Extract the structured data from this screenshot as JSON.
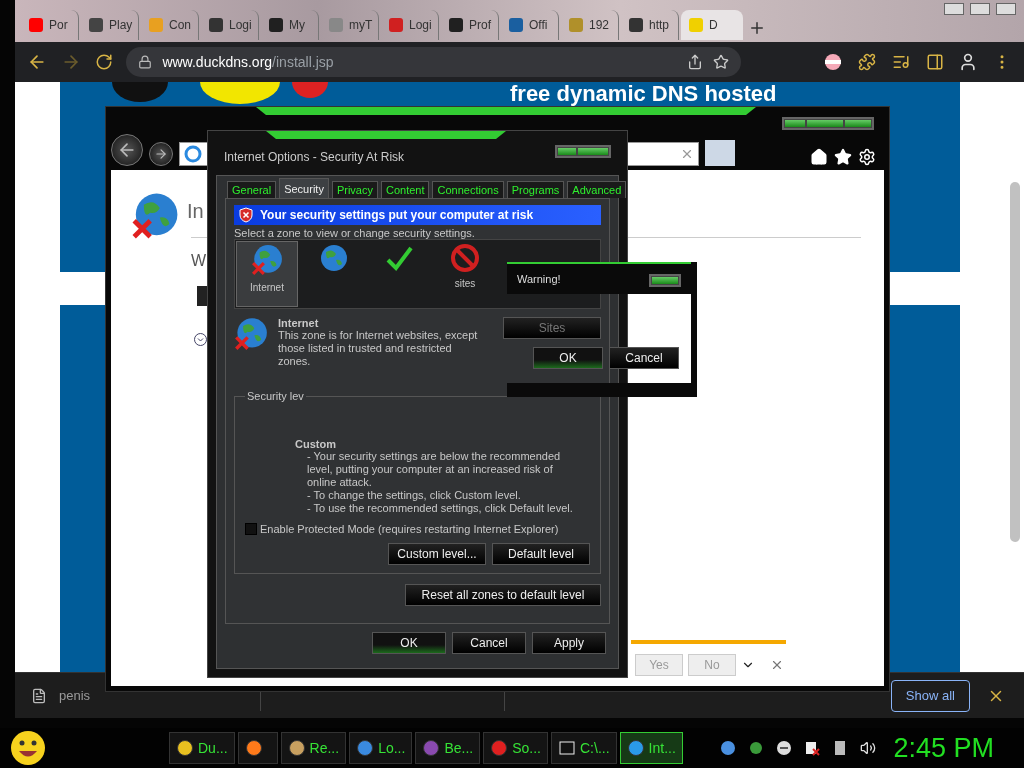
{
  "browser": {
    "tabs": [
      {
        "label": "Por",
        "color": "#ff0000",
        "selected": false
      },
      {
        "label": "Play",
        "color": "#444444",
        "selected": false
      },
      {
        "label": "Con",
        "color": "#e8a020",
        "selected": false
      },
      {
        "label": "Logi",
        "color": "#333333",
        "selected": false
      },
      {
        "label": "My",
        "color": "#202020",
        "selected": false
      },
      {
        "label": "myT",
        "color": "#888888",
        "selected": false
      },
      {
        "label": "Logi",
        "color": "#d02020",
        "selected": false
      },
      {
        "label": "Prof",
        "color": "#202020",
        "selected": false
      },
      {
        "label": "Offi",
        "color": "#1a5fa0",
        "selected": false
      },
      {
        "label": "192",
        "color": "#b0902a",
        "selected": false
      },
      {
        "label": "http",
        "color": "#333333",
        "selected": false
      },
      {
        "label": "D",
        "color": "#f0d000",
        "selected": true
      }
    ],
    "address": {
      "domain": "www.duckdns.org",
      "path": "/install.jsp"
    }
  },
  "page": {
    "heading": "free dynamic DNS hosted"
  },
  "ie_window": {
    "page_title": "In",
    "page_text": "W",
    "notification": {
      "buttons": [
        "Yes",
        "No"
      ]
    }
  },
  "options_dialog": {
    "title": "Internet Options - Security At Risk",
    "tabs": [
      {
        "label": "General",
        "selected": false
      },
      {
        "label": "Security",
        "selected": true
      },
      {
        "label": "Privacy",
        "selected": false
      },
      {
        "label": "Content",
        "selected": false
      },
      {
        "label": "Connections",
        "selected": false
      },
      {
        "label": "Programs",
        "selected": false
      },
      {
        "label": "Advanced",
        "selected": false
      }
    ],
    "banner": "Your security settings put your computer at risk",
    "zone_prompt": "Select a zone to view or change security settings.",
    "zones": [
      {
        "kind": "internet",
        "label": "Internet",
        "selected": true
      },
      {
        "kind": "intranet",
        "selected": false
      },
      {
        "kind": "trusted",
        "selected": false
      },
      {
        "kind": "restricted",
        "label": "sites",
        "selected": false
      }
    ],
    "zone_name": "Internet",
    "zone_description": "This zone is for Internet websites, except those listed in trusted and restricted zones.",
    "sites_button": "Sites",
    "level_legend": "Security lev",
    "level_name": "Custom",
    "level_notes": [
      "- Your security settings are below the recommended level, putting your computer at an increased risk of online attack.",
      "- To change the settings, click Custom level.",
      "- To use the recommended settings, click Default level."
    ],
    "protected_mode": {
      "label": "Enable Protected Mode (requires restarting Internet Explorer)",
      "checked": false
    },
    "level_buttons": [
      "Custom level...",
      "Default level"
    ],
    "reset_button": "Reset all zones to default level",
    "buttons": [
      "OK",
      "Cancel",
      "Apply"
    ]
  },
  "warning_dialog": {
    "title": "Warning!",
    "buttons": [
      {
        "label": "OK",
        "selected": true
      },
      {
        "label": "Cancel",
        "selected": false
      }
    ]
  },
  "download_bar": {
    "file": "penis",
    "show_all": "Show all"
  },
  "taskbar": {
    "items": [
      {
        "kind": "chrome",
        "label": "Du...",
        "selected": false
      },
      {
        "kind": "firefox",
        "selected": false
      },
      {
        "kind": "reader",
        "label": "Re...",
        "selected": false
      },
      {
        "kind": "globe",
        "label": "Lo...",
        "selected": false
      },
      {
        "kind": "gem",
        "label": "Be...",
        "selected": false
      },
      {
        "kind": "swirl",
        "label": "So...",
        "selected": false
      },
      {
        "kind": "archive",
        "label": "C:\\...",
        "selected": false
      },
      {
        "kind": "ie",
        "label": "Int...",
        "selected": true
      }
    ],
    "clock": "2:45 PM"
  }
}
